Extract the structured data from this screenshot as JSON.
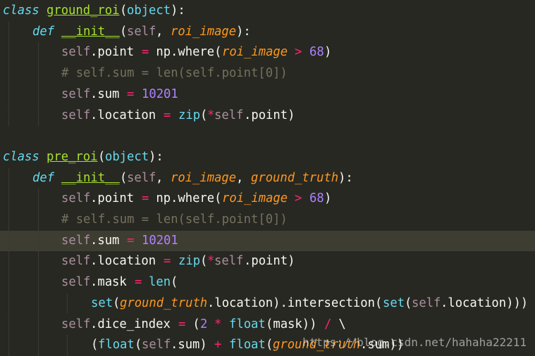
{
  "code": [
    {
      "indent": 0,
      "hl": false,
      "tokens": [
        {
          "t": "class",
          "c": "kw"
        },
        {
          "t": " ",
          "c": "txt"
        },
        {
          "t": "ground_roi",
          "c": "cls"
        },
        {
          "t": "(",
          "c": "punc"
        },
        {
          "t": "object",
          "c": "builtin"
        },
        {
          "t": "):",
          "c": "punc"
        }
      ]
    },
    {
      "indent": 1,
      "hl": false,
      "tokens": [
        {
          "t": "def",
          "c": "kw"
        },
        {
          "t": " ",
          "c": "txt"
        },
        {
          "t": "__init__",
          "c": "fn"
        },
        {
          "t": "(",
          "c": "punc"
        },
        {
          "t": "self",
          "c": "self"
        },
        {
          "t": ", ",
          "c": "punc"
        },
        {
          "t": "roi_image",
          "c": "param"
        },
        {
          "t": "):",
          "c": "punc"
        }
      ]
    },
    {
      "indent": 2,
      "hl": false,
      "tokens": [
        {
          "t": "self",
          "c": "self"
        },
        {
          "t": ".point ",
          "c": "txt"
        },
        {
          "t": "=",
          "c": "op"
        },
        {
          "t": " np.where(",
          "c": "txt"
        },
        {
          "t": "roi_image",
          "c": "param"
        },
        {
          "t": " ",
          "c": "txt"
        },
        {
          "t": ">",
          "c": "op"
        },
        {
          "t": " ",
          "c": "txt"
        },
        {
          "t": "68",
          "c": "num"
        },
        {
          "t": ")",
          "c": "txt"
        }
      ]
    },
    {
      "indent": 2,
      "hl": false,
      "tokens": [
        {
          "t": "# self.sum = len(self.point[0])",
          "c": "cmt"
        }
      ]
    },
    {
      "indent": 2,
      "hl": false,
      "tokens": [
        {
          "t": "self",
          "c": "self"
        },
        {
          "t": ".sum ",
          "c": "txt"
        },
        {
          "t": "=",
          "c": "op"
        },
        {
          "t": " ",
          "c": "txt"
        },
        {
          "t": "10201",
          "c": "num"
        }
      ]
    },
    {
      "indent": 2,
      "hl": false,
      "tokens": [
        {
          "t": "self",
          "c": "self"
        },
        {
          "t": ".location ",
          "c": "txt"
        },
        {
          "t": "=",
          "c": "op"
        },
        {
          "t": " ",
          "c": "txt"
        },
        {
          "t": "zip",
          "c": "builtin"
        },
        {
          "t": "(",
          "c": "txt"
        },
        {
          "t": "*",
          "c": "op"
        },
        {
          "t": "self",
          "c": "self"
        },
        {
          "t": ".point)",
          "c": "txt"
        }
      ]
    },
    {
      "indent": 0,
      "hl": false,
      "tokens": []
    },
    {
      "indent": 0,
      "hl": false,
      "tokens": [
        {
          "t": "class",
          "c": "kw"
        },
        {
          "t": " ",
          "c": "txt"
        },
        {
          "t": "pre_roi",
          "c": "cls"
        },
        {
          "t": "(",
          "c": "punc"
        },
        {
          "t": "object",
          "c": "builtin"
        },
        {
          "t": "):",
          "c": "punc"
        }
      ]
    },
    {
      "indent": 1,
      "hl": false,
      "tokens": [
        {
          "t": "def",
          "c": "kw"
        },
        {
          "t": " ",
          "c": "txt"
        },
        {
          "t": "__init__",
          "c": "fn"
        },
        {
          "t": "(",
          "c": "punc"
        },
        {
          "t": "self",
          "c": "self"
        },
        {
          "t": ", ",
          "c": "punc"
        },
        {
          "t": "roi_image",
          "c": "param"
        },
        {
          "t": ", ",
          "c": "punc"
        },
        {
          "t": "ground_truth",
          "c": "param"
        },
        {
          "t": "):",
          "c": "punc"
        }
      ]
    },
    {
      "indent": 2,
      "hl": false,
      "tokens": [
        {
          "t": "self",
          "c": "self"
        },
        {
          "t": ".point ",
          "c": "txt"
        },
        {
          "t": "=",
          "c": "op"
        },
        {
          "t": " np.where(",
          "c": "txt"
        },
        {
          "t": "roi_image",
          "c": "param"
        },
        {
          "t": " ",
          "c": "txt"
        },
        {
          "t": ">",
          "c": "op"
        },
        {
          "t": " ",
          "c": "txt"
        },
        {
          "t": "68",
          "c": "num"
        },
        {
          "t": ")",
          "c": "txt"
        }
      ]
    },
    {
      "indent": 2,
      "hl": false,
      "tokens": [
        {
          "t": "# self.sum = len(self.point[0])",
          "c": "cmt"
        }
      ]
    },
    {
      "indent": 2,
      "hl": true,
      "tokens": [
        {
          "t": "self",
          "c": "self"
        },
        {
          "t": ".sum ",
          "c": "txt"
        },
        {
          "t": "=",
          "c": "op"
        },
        {
          "t": " ",
          "c": "txt"
        },
        {
          "t": "10201",
          "c": "num"
        }
      ]
    },
    {
      "indent": 2,
      "hl": false,
      "tokens": [
        {
          "t": "self",
          "c": "self"
        },
        {
          "t": ".location ",
          "c": "txt"
        },
        {
          "t": "=",
          "c": "op"
        },
        {
          "t": " ",
          "c": "txt"
        },
        {
          "t": "zip",
          "c": "builtin"
        },
        {
          "t": "(",
          "c": "txt"
        },
        {
          "t": "*",
          "c": "op"
        },
        {
          "t": "self",
          "c": "self"
        },
        {
          "t": ".point)",
          "c": "txt"
        }
      ]
    },
    {
      "indent": 2,
      "hl": false,
      "tokens": [
        {
          "t": "self",
          "c": "self"
        },
        {
          "t": ".mask ",
          "c": "txt"
        },
        {
          "t": "=",
          "c": "op"
        },
        {
          "t": " ",
          "c": "txt"
        },
        {
          "t": "len",
          "c": "builtin"
        },
        {
          "t": "(",
          "c": "txt"
        }
      ]
    },
    {
      "indent": 3,
      "hl": false,
      "tokens": [
        {
          "t": "set",
          "c": "builtin"
        },
        {
          "t": "(",
          "c": "txt"
        },
        {
          "t": "ground_truth",
          "c": "param"
        },
        {
          "t": ".location).intersection(",
          "c": "txt"
        },
        {
          "t": "set",
          "c": "builtin"
        },
        {
          "t": "(",
          "c": "txt"
        },
        {
          "t": "self",
          "c": "self"
        },
        {
          "t": ".location)))",
          "c": "txt"
        }
      ]
    },
    {
      "indent": 2,
      "hl": false,
      "tokens": [
        {
          "t": "self",
          "c": "self"
        },
        {
          "t": ".dice_index ",
          "c": "txt"
        },
        {
          "t": "=",
          "c": "op"
        },
        {
          "t": " (",
          "c": "txt"
        },
        {
          "t": "2",
          "c": "num"
        },
        {
          "t": " ",
          "c": "txt"
        },
        {
          "t": "*",
          "c": "op"
        },
        {
          "t": " ",
          "c": "txt"
        },
        {
          "t": "float",
          "c": "builtin"
        },
        {
          "t": "(mask)) ",
          "c": "txt"
        },
        {
          "t": "/",
          "c": "op"
        },
        {
          "t": " \\",
          "c": "txt"
        }
      ]
    },
    {
      "indent": 3,
      "hl": false,
      "tokens": [
        {
          "t": "(",
          "c": "txt"
        },
        {
          "t": "float",
          "c": "builtin"
        },
        {
          "t": "(",
          "c": "txt"
        },
        {
          "t": "self",
          "c": "self"
        },
        {
          "t": ".sum) ",
          "c": "txt"
        },
        {
          "t": "+",
          "c": "op"
        },
        {
          "t": " ",
          "c": "txt"
        },
        {
          "t": "float",
          "c": "builtin"
        },
        {
          "t": "(",
          "c": "txt"
        },
        {
          "t": "ground_truth",
          "c": "param"
        },
        {
          "t": ".sum))",
          "c": "txt"
        }
      ]
    }
  ],
  "watermark": "https://blog.csdn.net/hahaha22211"
}
